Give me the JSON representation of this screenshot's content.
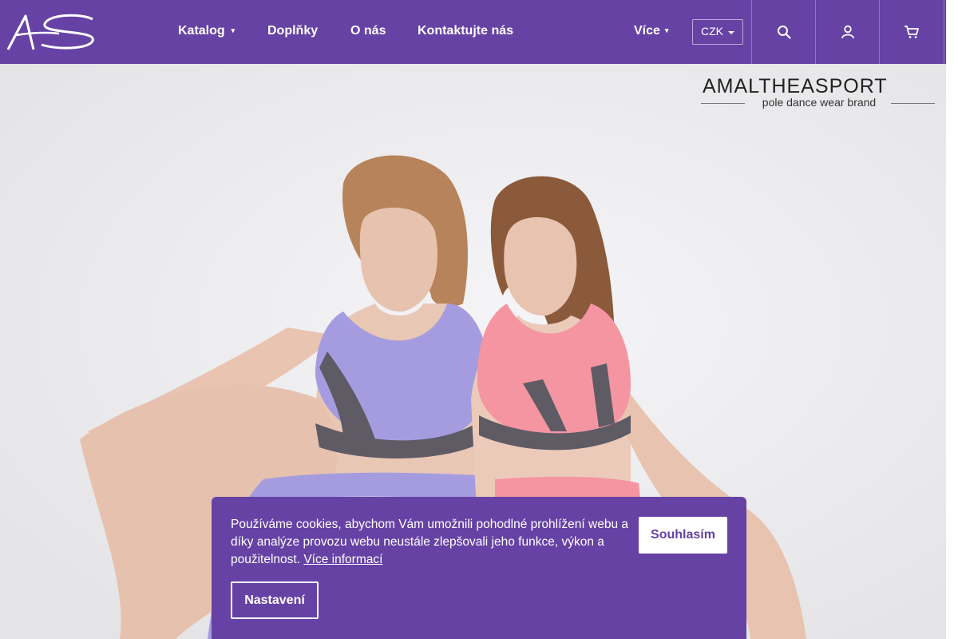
{
  "header": {
    "logo_text": "AS",
    "nav": [
      {
        "label": "Katalog",
        "has_dropdown": true
      },
      {
        "label": "Doplňky",
        "has_dropdown": false
      },
      {
        "label": "O nás",
        "has_dropdown": false
      },
      {
        "label": "Kontaktujte nás",
        "has_dropdown": false
      }
    ],
    "more_label": "Více",
    "currency": "CZK",
    "icons": [
      "search-icon",
      "user-icon",
      "cart-icon"
    ],
    "colors": {
      "header_bg": "#6642a4",
      "text": "#ffffff"
    }
  },
  "hero": {
    "brand_name": "AMALTHEASPORT",
    "brand_tagline": "pole dance wear brand",
    "image_description_icon": "hero-photo"
  },
  "cookie": {
    "message": "Používáme cookies, abychom Vám umožnili pohodlné prohlížení webu a díky analýze provozu webu neustále zlepšovali jeho funkce, výkon a použitelnost.",
    "more_info_link": "Více informací",
    "agree_label": "Souhlasím",
    "settings_label": "Nastavení",
    "colors": {
      "bg": "#6642a4",
      "button_bg": "#ffffff"
    }
  }
}
